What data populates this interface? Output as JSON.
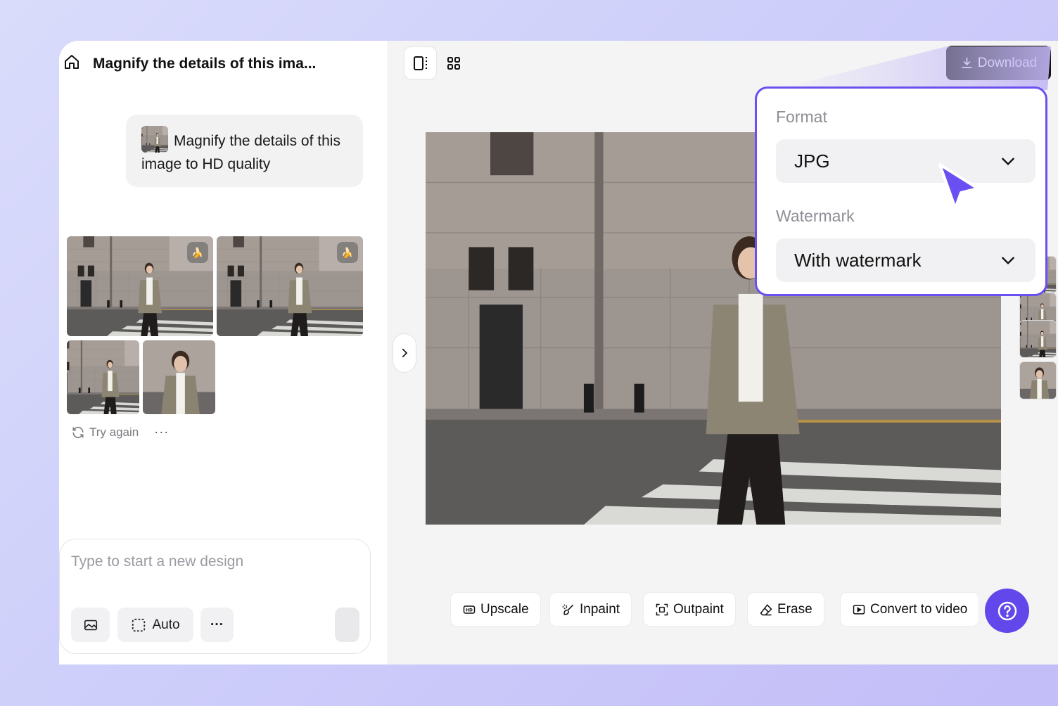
{
  "chat": {
    "title": "Magnify the details of this ima...",
    "prompt": "Magnify the details of this image to HD quality",
    "retry_label": "Try again",
    "more_label": "···"
  },
  "composer": {
    "placeholder": "Type to start a new design",
    "auto_label": "Auto",
    "more_label": "···"
  },
  "toolbar": {
    "download_label": "Download"
  },
  "download_menu": {
    "format_label": "Format",
    "format_value": "JPG",
    "watermark_label": "Watermark",
    "watermark_value": "With watermark"
  },
  "tools": [
    {
      "label": "Upscale",
      "icon": "hd-icon"
    },
    {
      "label": "Inpaint",
      "icon": "brush-icon"
    },
    {
      "label": "Outpaint",
      "icon": "expand-icon"
    },
    {
      "label": "Erase",
      "icon": "eraser-icon"
    },
    {
      "label": "Convert to video",
      "icon": "play-icon"
    }
  ],
  "colors": {
    "accent": "#6247ea",
    "accent_border": "#6b4ff0",
    "download_bg": "#111111"
  }
}
